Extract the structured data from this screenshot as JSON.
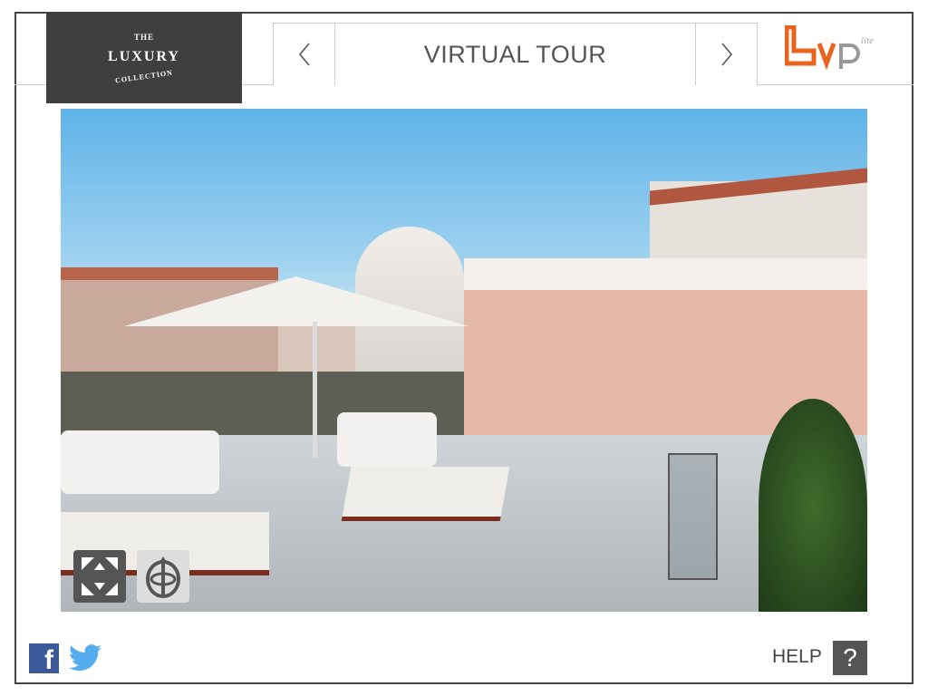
{
  "header": {
    "logo": {
      "line1": "THE",
      "line2": "LUXURY",
      "line3": "COLLECTION"
    },
    "title": "VIRTUAL TOUR",
    "prev_icon": "chevron-left-icon",
    "next_icon": "chevron-right-icon",
    "brand_logo": {
      "text": "vp",
      "suffix": "lite",
      "color": "#e8641e"
    }
  },
  "viewer": {
    "controls": [
      {
        "icon": "fullscreen-icon"
      },
      {
        "icon": "navigation-360-icon"
      }
    ]
  },
  "footer": {
    "social": [
      {
        "icon": "facebook-icon",
        "color": "#3b5998"
      },
      {
        "icon": "twitter-icon",
        "color": "#55acee"
      }
    ],
    "help_label": "HELP",
    "help_icon": "?"
  }
}
